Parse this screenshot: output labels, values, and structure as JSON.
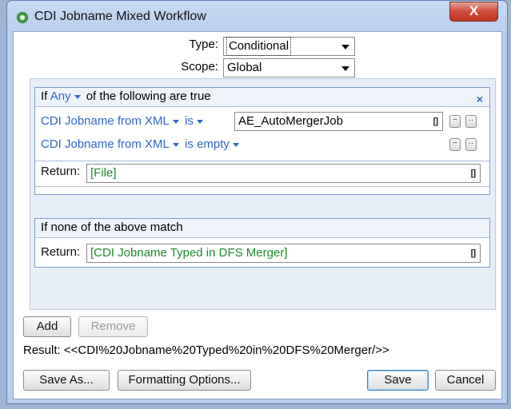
{
  "window": {
    "title": "CDI Jobname Mixed Workflow",
    "close_glyph": "X"
  },
  "settings": {
    "type_label": "Type:",
    "type_value": "Conditional",
    "scope_label": "Scope:",
    "scope_value": "Global"
  },
  "rule_block": {
    "if_word": "If",
    "match_mode": "Any",
    "header_suffix": "of the following are true",
    "remove_glyph": "×",
    "conditions": [
      {
        "field": "CDI Jobname from XML",
        "operator": "is",
        "value": "AE_AutoMergerJob",
        "bracket_glyph": "[]",
        "minus_glyph": "−",
        "more_glyph": "··"
      },
      {
        "field": "CDI Jobname from XML",
        "operator": "is empty",
        "minus_glyph": "−",
        "more_glyph": "··"
      }
    ],
    "return_label": "Return:",
    "return_value": "[File]",
    "return_bracket_glyph": "[]"
  },
  "else_block": {
    "header": "If none of the above match",
    "return_label": "Return:",
    "return_value": "[CDI Jobname Typed in DFS Merger]",
    "return_bracket_glyph": "[]"
  },
  "actions": {
    "add_label": "Add",
    "remove_label": "Remove"
  },
  "result": {
    "text": "Result: <<CDI%20Jobname%20Typed%20in%20DFS%20Merger/>>"
  },
  "footer": {
    "save_as_label": "Save As...",
    "formatting_label": "Formatting Options...",
    "save_label": "Save",
    "cancel_label": "Cancel"
  },
  "colors": {
    "link_blue": "#2f66c9",
    "value_green": "#1f8a2c",
    "close_red": "#c03724",
    "title_bar": "#b9cfee"
  }
}
